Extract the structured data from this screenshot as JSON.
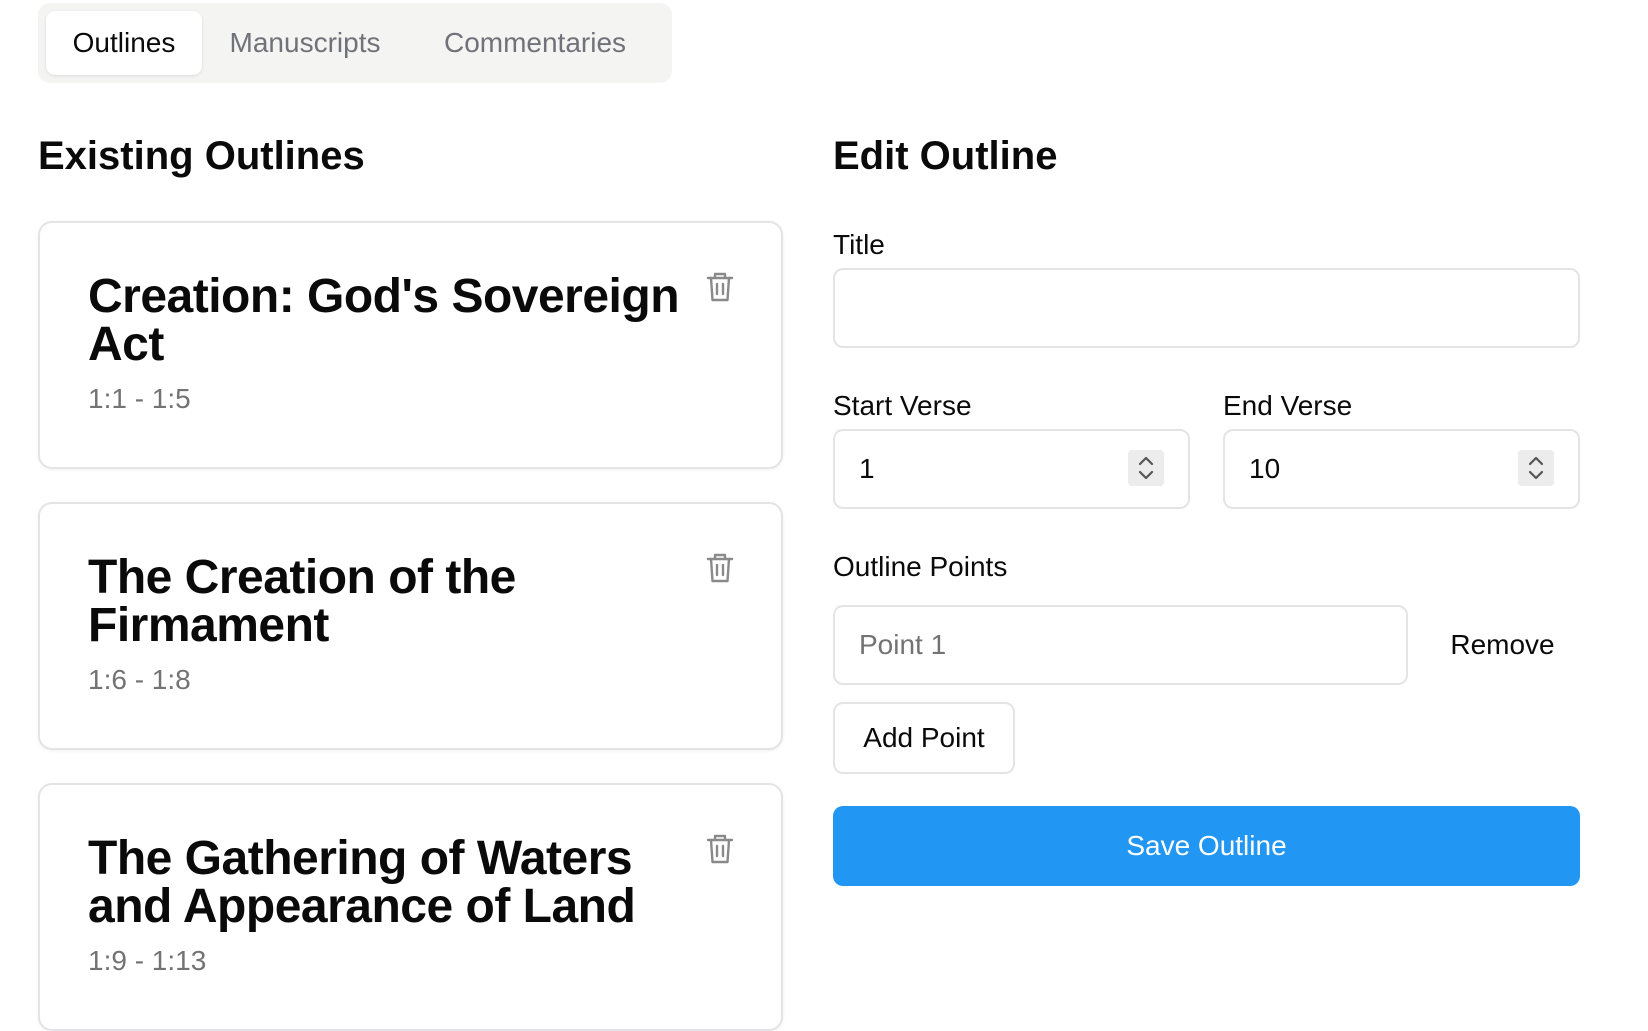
{
  "tabs": [
    {
      "label": "Outlines",
      "active": true
    },
    {
      "label": "Manuscripts",
      "active": false
    },
    {
      "label": "Commentaries",
      "active": false
    }
  ],
  "existing": {
    "heading": "Existing Outlines",
    "outlines": [
      {
        "title": "Creation: God's Sovereign Act",
        "range": "1:1 - 1:5"
      },
      {
        "title": "The Creation of the Firmament",
        "range": "1:6 - 1:8"
      },
      {
        "title": "The Gathering of Waters and Appearance of Land",
        "range": "1:9 - 1:13"
      }
    ]
  },
  "edit": {
    "heading": "Edit Outline",
    "title_label": "Title",
    "title_value": "",
    "start_label": "Start Verse",
    "start_value": "1",
    "end_label": "End Verse",
    "end_value": "10",
    "points_label": "Outline Points",
    "point_placeholder": "Point 1",
    "remove_label": "Remove",
    "add_point_label": "Add Point",
    "save_label": "Save Outline"
  },
  "colors": {
    "primary": "#2196f3",
    "border": "#e4e4e7",
    "muted": "#737373"
  }
}
